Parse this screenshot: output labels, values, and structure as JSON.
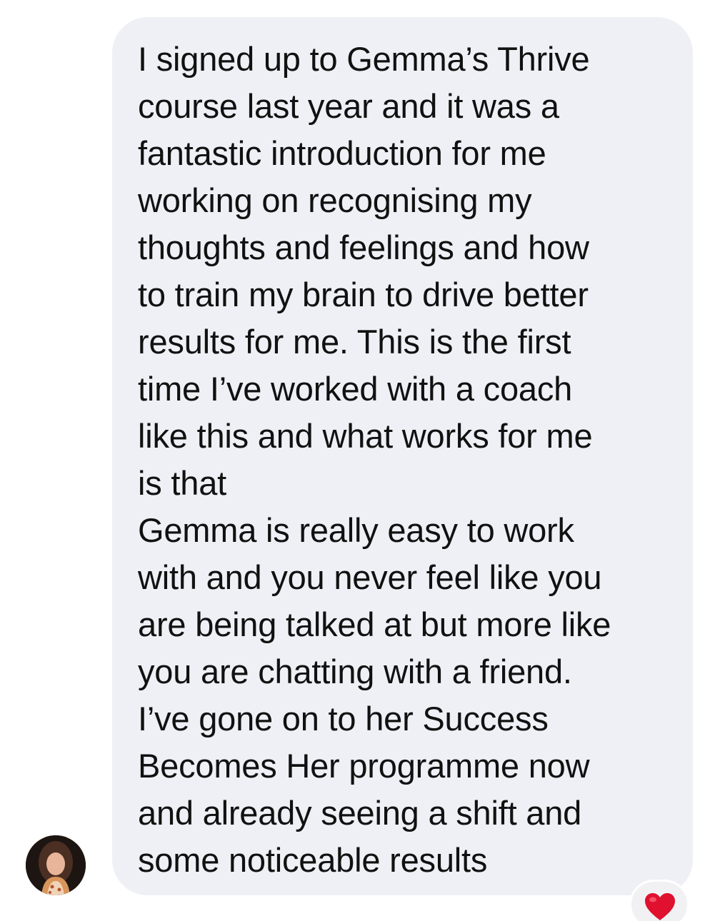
{
  "message": {
    "text": "I signed up to Gemma’s Thrive\ncourse last year and it was a\nfantastic introduction for me\nworking on recognising my\nthoughts and feelings and how\nto train my brain to drive better\nresults for me.  This is the first\ntime I’ve worked with a coach\nlike this and what works for me\nis that\nGemma is really easy to work\nwith and you never feel like you\nare being talked at but more like\nyou are chatting with a friend.\nI’ve gone on to her Success\nBecomes Her programme now\nand already seeing a shift and\nsome noticeable results",
    "bubble_color": "#eff0f5",
    "text_color": "#111111"
  },
  "sender": {
    "avatar_icon": "profile-photo"
  },
  "reaction": {
    "icon": "heart-icon",
    "color": "#e0102f"
  }
}
